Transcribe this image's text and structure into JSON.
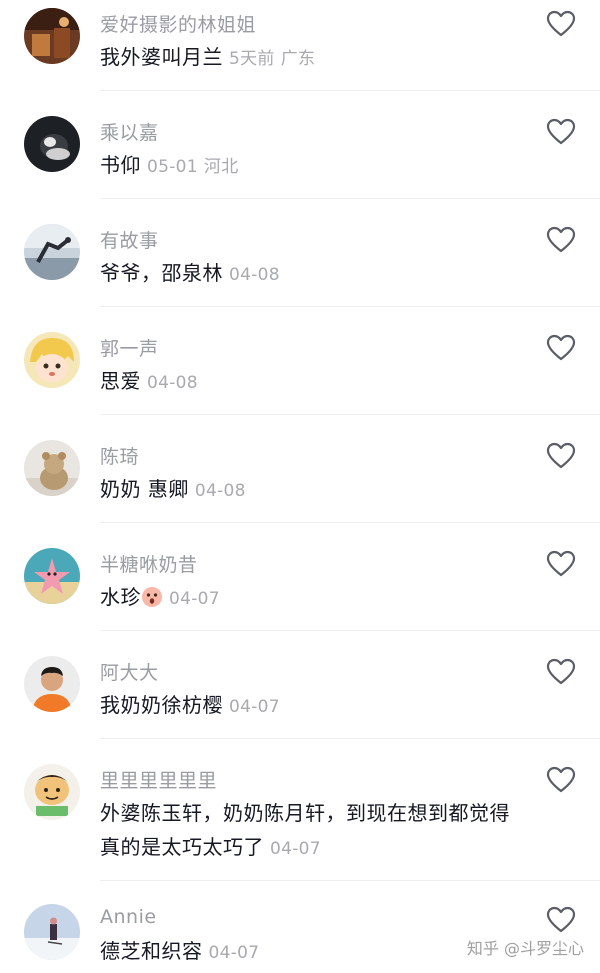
{
  "comments": [
    {
      "username": "爱好摄影的林姐姐",
      "text": "我外婆叫月兰",
      "date": "5天前",
      "location": "广东",
      "avatar": "brown-room-photo"
    },
    {
      "username": "乘以嘉",
      "text": "书仰",
      "date": "05-01",
      "location": "河北",
      "avatar": "black-cat-photo"
    },
    {
      "username": "有故事",
      "text": "爷爷，邵泉林",
      "date": "04-08",
      "location": "",
      "avatar": "seaside-figure-photo"
    },
    {
      "username": "郭一声",
      "text": "思爱",
      "date": "04-08",
      "location": "",
      "avatar": "cartoon-girl-photo"
    },
    {
      "username": "陈琦",
      "text": "奶奶 惠卿",
      "date": "04-08",
      "location": "",
      "avatar": "teddy-bear-photo"
    },
    {
      "username": "半糖咻奶昔",
      "text": "水珍",
      "date": "04-07",
      "location": "",
      "avatar": "starfish-cartoon-photo"
    },
    {
      "username": "阿大大",
      "text": "我奶奶徐枋樱",
      "date": "04-07",
      "location": "",
      "avatar": "boy-orange-shirt-photo"
    },
    {
      "username": "里里里里里里",
      "text": "外婆陈玉轩，奶奶陈月轩，到现在想到都觉得真的是太巧太巧了",
      "date": "04-07",
      "location": "",
      "avatar": "meme-face-photo"
    },
    {
      "username": "Annie",
      "text": "德芝和织容",
      "date": "04-07",
      "location": "",
      "avatar": "snow-skier-photo"
    }
  ],
  "watermark": "知乎 @斗罗尘心",
  "colors": {
    "username": "#9a9ca3",
    "text": "#161823",
    "meta": "#a8aab0",
    "divider": "#eeeeee"
  },
  "icons": {
    "like": "heart-outline-icon",
    "inline_emoji": "shocked-face-emoji"
  }
}
